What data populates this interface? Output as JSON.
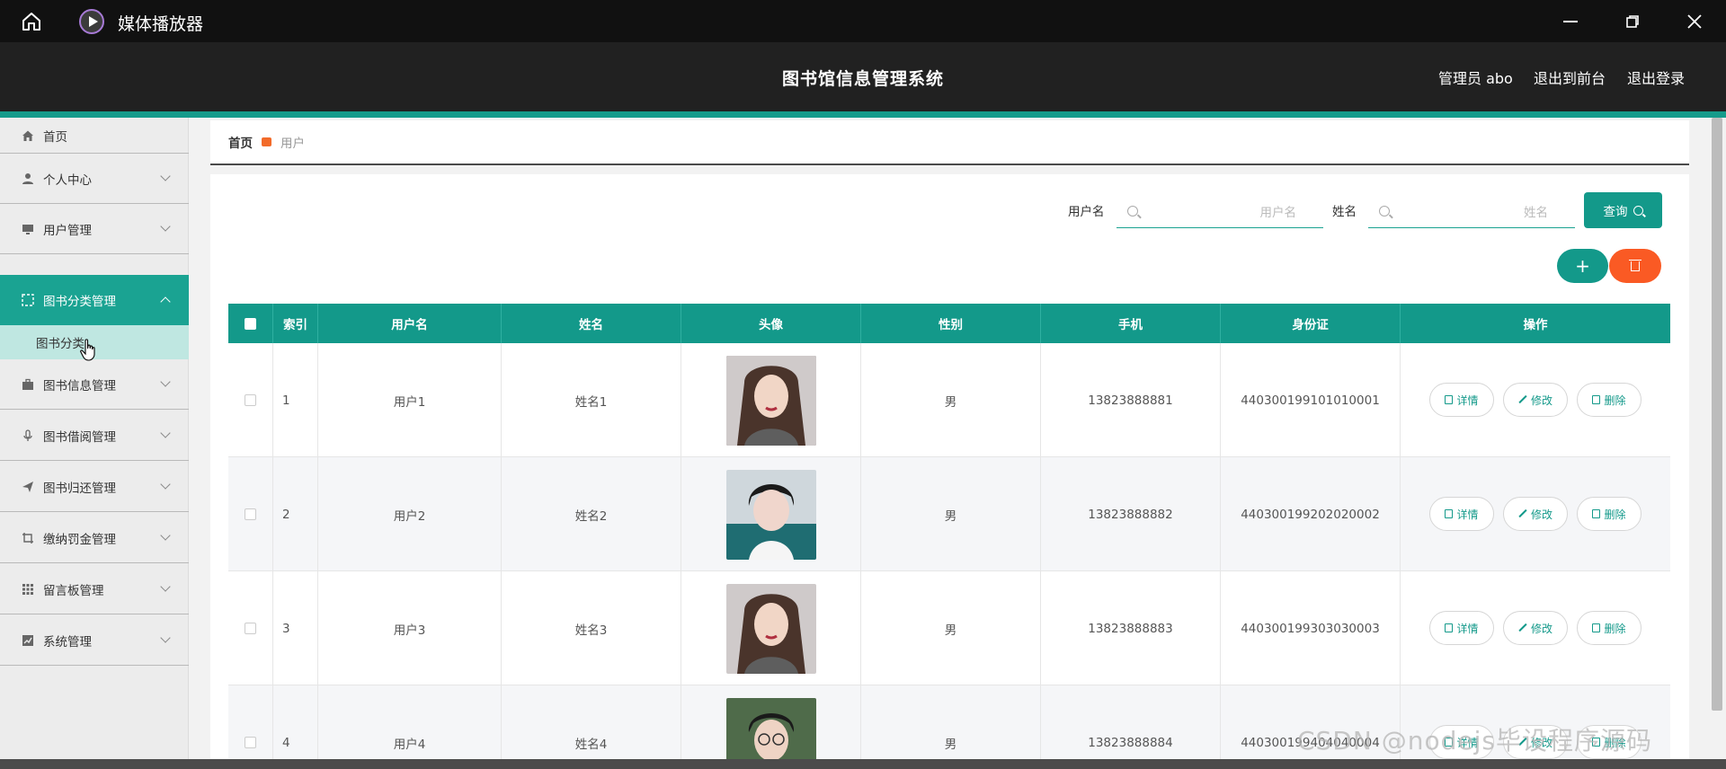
{
  "window": {
    "title": "媒体播放器"
  },
  "header": {
    "system_title": "图书馆信息管理系统",
    "admin_label": "管理员 abo",
    "to_frontend": "退出到前台",
    "logout": "退出登录"
  },
  "sidebar": {
    "items": [
      {
        "label": "首页",
        "icon": "home-icon"
      },
      {
        "label": "个人中心",
        "icon": "user-icon"
      },
      {
        "label": "用户管理",
        "icon": "monitor-icon"
      },
      {
        "label": "图书分类管理",
        "icon": "category-icon"
      },
      {
        "label": "图书信息管理",
        "icon": "briefcase-icon"
      },
      {
        "label": "图书借阅管理",
        "icon": "microphone-icon"
      },
      {
        "label": "图书归还管理",
        "icon": "send-icon"
      },
      {
        "label": "缴纳罚金管理",
        "icon": "crop-icon"
      },
      {
        "label": "留言板管理",
        "icon": "grid-icon"
      },
      {
        "label": "系统管理",
        "icon": "chart-icon"
      }
    ],
    "active_submenu": "图书分类"
  },
  "breadcrumb": {
    "home": "首页",
    "current": "用户"
  },
  "search": {
    "username_label": "用户名",
    "username_placeholder": "用户名",
    "name_label": "姓名",
    "name_placeholder": "姓名",
    "query_button": "查询"
  },
  "actions": {
    "add": "+"
  },
  "table": {
    "columns": [
      "索引",
      "用户名",
      "姓名",
      "头像",
      "性别",
      "手机",
      "身份证",
      "操作"
    ],
    "rows": [
      {
        "index": "1",
        "username": "用户1",
        "name": "姓名1",
        "gender": "男",
        "phone": "13823888881",
        "id_card": "440300199101010001"
      },
      {
        "index": "2",
        "username": "用户2",
        "name": "姓名2",
        "gender": "男",
        "phone": "13823888882",
        "id_card": "440300199202020002"
      },
      {
        "index": "3",
        "username": "用户3",
        "name": "姓名3",
        "gender": "男",
        "phone": "13823888883",
        "id_card": "440300199303030003"
      },
      {
        "index": "4",
        "username": "用户4",
        "name": "姓名4",
        "gender": "男",
        "phone": "13823888884",
        "id_card": "440300199404040004"
      }
    ],
    "row_actions": {
      "detail": "详情",
      "edit": "修改",
      "delete": "删除"
    }
  },
  "watermark": "CSDN @nodejs毕设程序源码",
  "colors": {
    "accent": "#13998a",
    "danger": "#fa5a24",
    "header_bg": "#212121",
    "titlebar_bg": "#111111"
  }
}
